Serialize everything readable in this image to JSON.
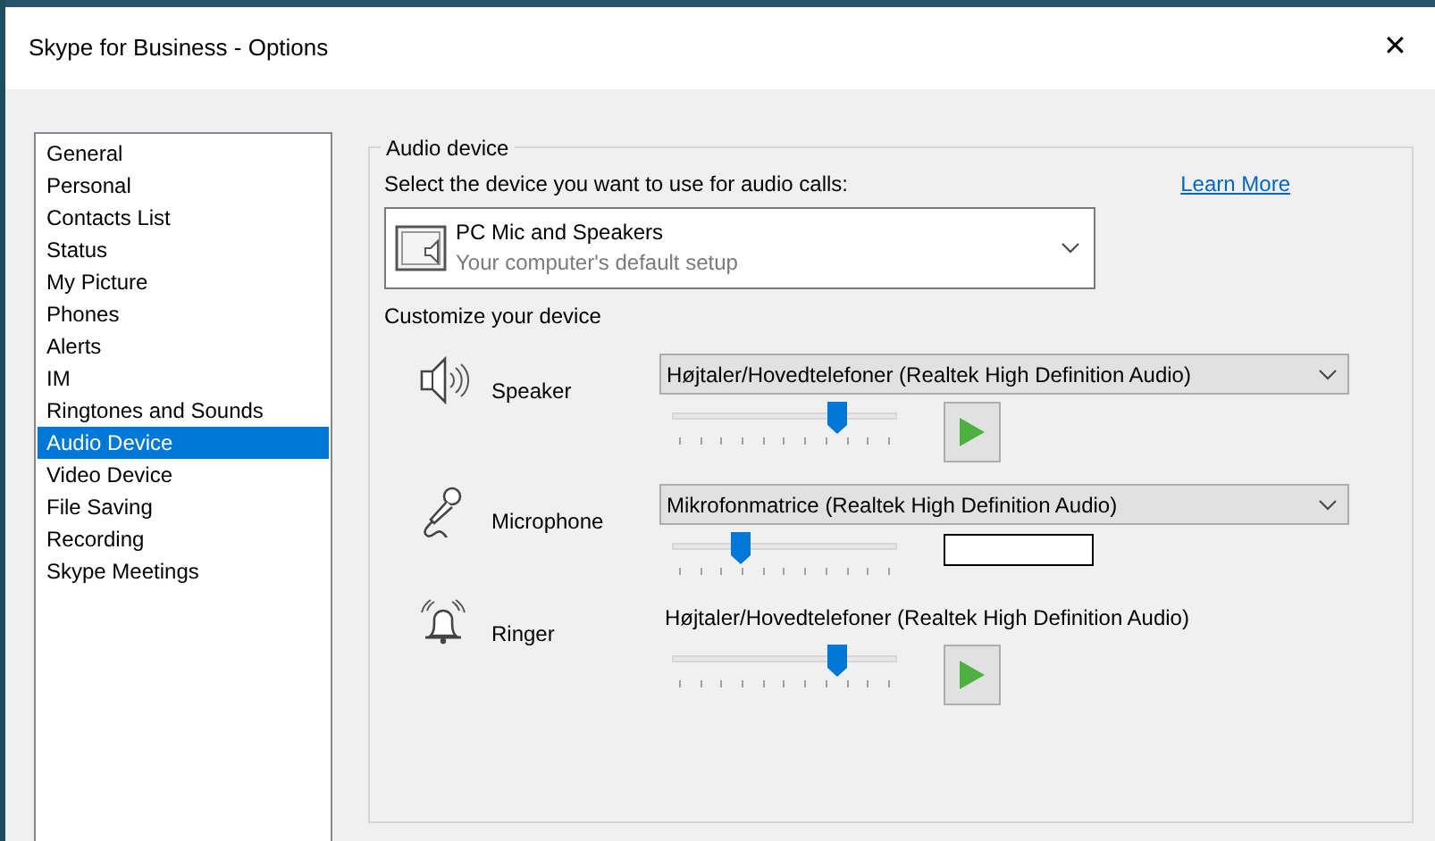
{
  "window": {
    "title": "Skype for Business - Options",
    "close": "✕"
  },
  "sidebar": {
    "items": [
      {
        "label": "General",
        "selected": false
      },
      {
        "label": "Personal",
        "selected": false
      },
      {
        "label": "Contacts List",
        "selected": false
      },
      {
        "label": "Status",
        "selected": false
      },
      {
        "label": "My Picture",
        "selected": false
      },
      {
        "label": "Phones",
        "selected": false
      },
      {
        "label": "Alerts",
        "selected": false
      },
      {
        "label": "IM",
        "selected": false
      },
      {
        "label": "Ringtones and Sounds",
        "selected": false
      },
      {
        "label": "Audio Device",
        "selected": true
      },
      {
        "label": "Video Device",
        "selected": false
      },
      {
        "label": "File Saving",
        "selected": false
      },
      {
        "label": "Recording",
        "selected": false
      },
      {
        "label": "Skype Meetings",
        "selected": false
      }
    ]
  },
  "audio_device": {
    "legend": "Audio device",
    "prompt": "Select the device you want to use for audio calls:",
    "learn_more": "Learn More",
    "device": {
      "name": "PC Mic and Speakers",
      "description": "Your computer's default setup"
    },
    "customize_label": "Customize your device",
    "devices": [
      {
        "kind": "speaker",
        "label": "Speaker",
        "selection": "Højtaler/Hovedtelefoner (Realtek High Definition Audio)",
        "level": 0.73
      },
      {
        "kind": "microphone",
        "label": "Microphone",
        "selection": "Mikrofonmatrice (Realtek High Definition Audio)",
        "level": 0.3
      },
      {
        "kind": "ringer",
        "label": "Ringer",
        "selection": "Højtaler/Hovedtelefoner (Realtek High Definition Audio)",
        "level": 0.73
      }
    ]
  }
}
